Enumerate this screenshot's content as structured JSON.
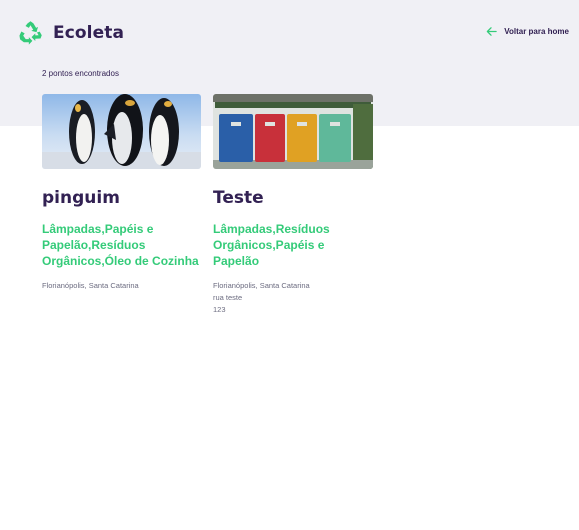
{
  "app": {
    "title": "Ecoleta",
    "logo_icon": "recycle-icon"
  },
  "header": {
    "back_label": "Voltar para home",
    "back_icon": "arrow-left-icon"
  },
  "results": {
    "count_label": "2 pontos encontrados"
  },
  "points": [
    {
      "name": "pinguim",
      "items": "Lâmpadas,Papéis e Papelão,Resíduos Orgânicos,Óleo de Cozinha",
      "city": "Florianópolis, Santa Catarina",
      "image": "penguins-photo"
    },
    {
      "name": "Teste",
      "items": "Lâmpadas,Resíduos Orgânicos,Papéis e Papelão",
      "city": "Florianópolis, Santa Catarina",
      "street": "rua teste",
      "number": "123",
      "image": "recycling-bins-photo"
    }
  ],
  "colors": {
    "primary": "#34cb79",
    "title": "#322153",
    "text": "#6c6c80",
    "background": "#f0f0f5"
  }
}
